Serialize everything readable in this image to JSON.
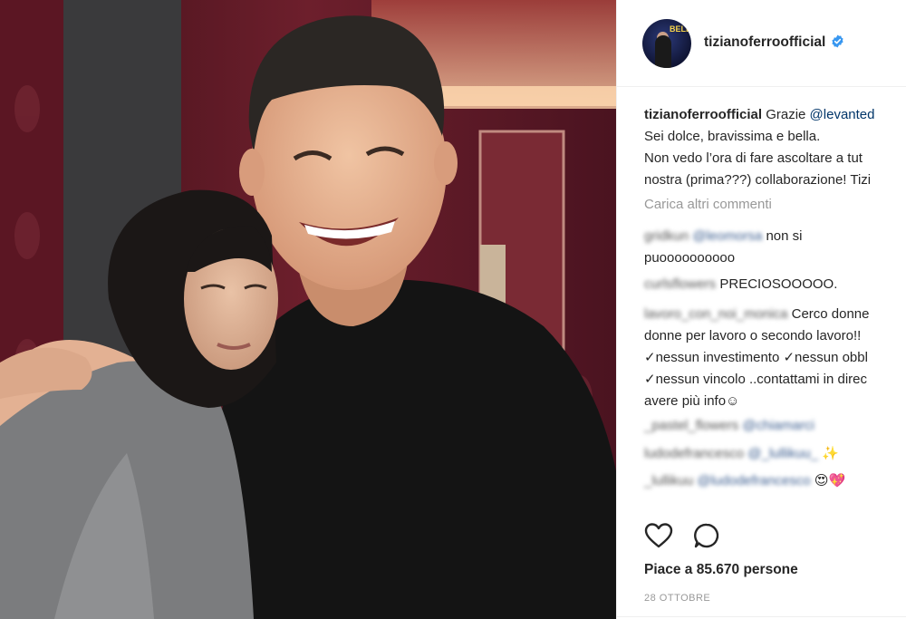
{
  "post": {
    "author": "tizianoferroofficial",
    "avatar_text": "BELLA",
    "caption": {
      "author": "tizianoferroofficial",
      "line1_text": "Grazie ",
      "line1_mention": "@levanted",
      "line2": "Sei dolce, bravissima e bella.",
      "line3": "Non vedo l’ora di fare ascoltare a tut",
      "line4": "nostra (prima???) collaborazione! Tizi"
    },
    "load_more": "Carica altri commenti",
    "comments": [
      {
        "user": "gridkun",
        "mention": "@leomorsa",
        "lines": [
          " non si",
          "puoooooooooo"
        ]
      },
      {
        "user": "curlsflowers",
        "lines": [
          " PRECIOSOOOOO."
        ]
      },
      {
        "user": "lavoro_con_noi_monica",
        "lines": [
          " Cerco donne",
          "donne per lavoro o secondo lavoro!!",
          "✓nessun investimento ✓nessun obbl",
          "✓nessun vincolo ..contattami in direc",
          "avere più info☺"
        ]
      },
      {
        "user": "_pastel_flowers",
        "mention": "@chiamarci"
      },
      {
        "user": "ludodefrancesco",
        "mention": "@_lullikuu_",
        "suffix": " ✨"
      },
      {
        "user": "_lullikuu",
        "mention": "@ludodefrancesco",
        "suffix": " 😍💖"
      }
    ],
    "likes": "Piace a 85.670 persone",
    "date": "28 OTTOBRE"
  },
  "icons": {
    "like": "heart-outline-icon",
    "comment": "speech-bubble-icon",
    "verified": "verified-badge-icon"
  },
  "colors": {
    "verified": "#3897f0",
    "muted": "#999999",
    "mention": "#003569",
    "text": "#262626"
  }
}
